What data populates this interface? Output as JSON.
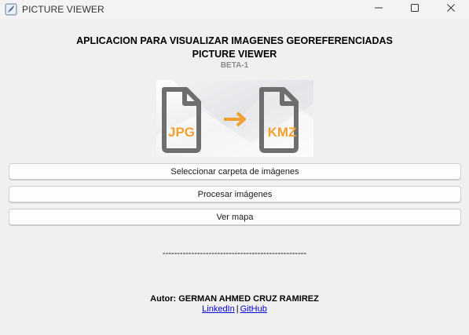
{
  "window": {
    "title": "PICTURE VIEWER",
    "icon": "app-feather-icon",
    "controls": [
      "minimize-icon",
      "maximize-icon",
      "close-icon"
    ]
  },
  "header": {
    "title": "APLICACION PARA VISUALIZAR IMAGENES GEOREFERENCIADAS",
    "subtitle": "PICTURE VIEWER",
    "version": "BETA-1"
  },
  "banner": {
    "from_label": "JPG",
    "to_label": "KMZ",
    "icons": [
      "document-icon",
      "arrow-right-icon",
      "document-icon"
    ],
    "accent_color": "#f0a030",
    "icon_color": "#6e6e6e"
  },
  "actions": {
    "select_folder": "Seleccionar carpeta de imágenes",
    "process_images": "Procesar imágenes",
    "view_map": "Ver mapa"
  },
  "footer": {
    "divider": "--------------------------------------------------",
    "author": "Autor: GERMAN AHMED CRUZ RAMIREZ",
    "linkedin": "LinkedIn",
    "separator": "|",
    "github": "GitHub"
  }
}
